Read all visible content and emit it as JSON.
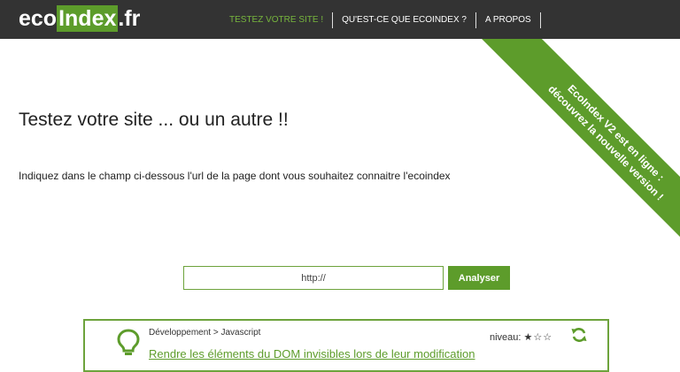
{
  "header": {
    "logo": {
      "prefix": "eco",
      "middle": "Index",
      "suffix": ".fr"
    },
    "nav": [
      {
        "label": "TESTEZ VOTRE SITE !",
        "active": true
      },
      {
        "label": "QU'EST-CE QUE ECOINDEX ?",
        "active": false
      },
      {
        "label": "A PROPOS",
        "active": false
      }
    ]
  },
  "ribbon": {
    "line1": "EcoIndex V2 est en ligne :",
    "line2": "découvrez la nouvelle version !"
  },
  "main": {
    "title": "Testez votre site ... ou un autre !!",
    "intro": "Indiquez dans le champ ci-dessous l'url de la page dont vous souhaitez connaitre l'ecoindex",
    "url_input": {
      "value": "",
      "placeholder": "http://"
    },
    "analyse_label": "Analyser"
  },
  "tip_card": {
    "breadcrumb": "Développement > Javascript",
    "level_label": "niveau:",
    "level_stars": {
      "filled": 1,
      "total": 3
    },
    "link_text": "Rendre les éléments du DOM invisibles lors de leur modification",
    "icon": "lightbulb-icon"
  },
  "colors": {
    "topbar": "#333333",
    "accent": "#5d9c2b",
    "nav_active": "#77b63d"
  }
}
